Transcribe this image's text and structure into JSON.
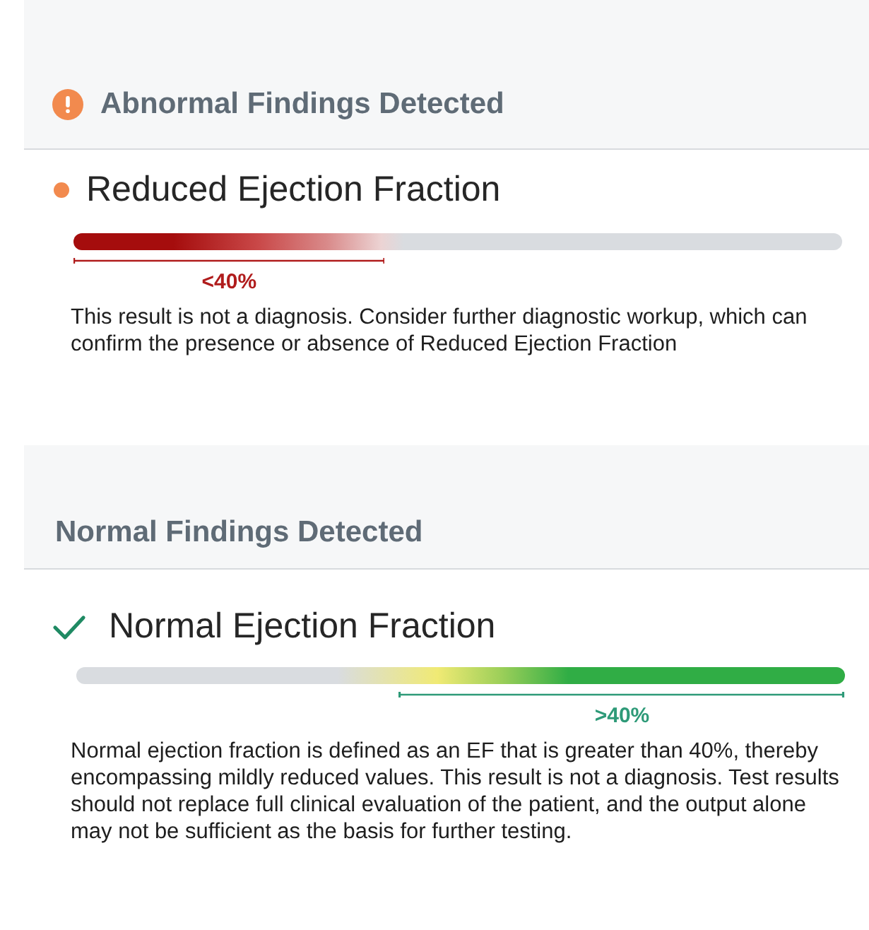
{
  "sections": [
    {
      "kind": "abnormal",
      "title": "Abnormal Findings Detected",
      "finding": {
        "kind": "reduced",
        "title": "Reduced Ejection Fraction",
        "range_label": "<40%",
        "description": "This result is not a diagnosis. Consider further diagnostic workup, which can confirm the presence or absence of Reduced Ejection Fraction"
      }
    },
    {
      "kind": "normal",
      "title": "Normal Findings Detected",
      "finding": {
        "kind": "normal",
        "title": "Normal Ejection Fraction",
        "range_label": ">40%",
        "description": "Normal ejection fraction is defined as an EF that is greater than 40%, thereby encompassing mildly reduced values. This result is not a diagnosis. Test results should not replace full clinical evaluation of the patient, and the output alone may not be sufficient as the basis for further testing."
      }
    }
  ]
}
